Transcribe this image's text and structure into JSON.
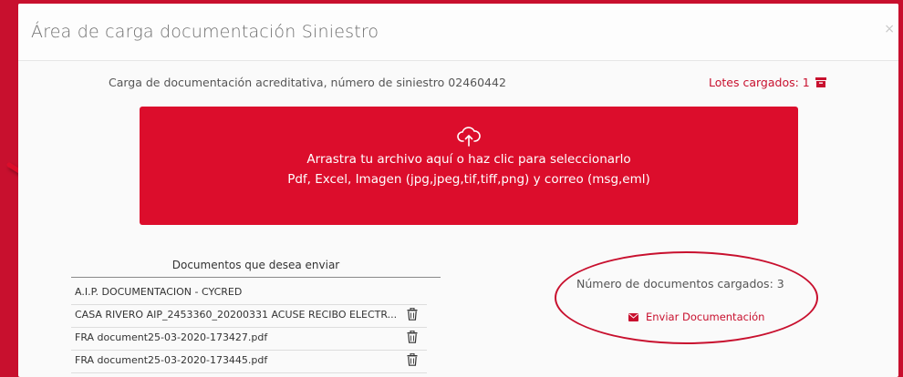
{
  "dialog": {
    "title": "Área de carga documentación Siniestro"
  },
  "upload": {
    "subtitle": "Carga de documentación acreditativa, número de siniestro 02460442",
    "lotes_label": "Lotes cargados: 1",
    "dropzone_line1": "Arrastra tu archivo aquí o haz clic para seleccionarlo",
    "dropzone_line2": "Pdf, Excel, Imagen (jpg,jpeg,tif,tiff,png) y correo (msg,eml)"
  },
  "documents": {
    "header": "Documentos que desea enviar",
    "items": [
      {
        "name": "A.I.P. DOCUMENTACION - CYCRED",
        "deletable": false
      },
      {
        "name": "CASA RIVERO AIP_2453360_20200331 ACUSE RECIBO ELECTR...",
        "deletable": true
      },
      {
        "name": "FRA document25-03-2020-173427.pdf",
        "deletable": true
      },
      {
        "name": "FRA document25-03-2020-173445.pdf",
        "deletable": true
      }
    ]
  },
  "summary": {
    "count_label": "Número de documentos cargados: 3",
    "send_label": "Enviar Documentación"
  },
  "icons": {
    "upload": "cloud-upload-icon",
    "lotes": "box-icon",
    "delete": "trash-icon",
    "send": "envelope-icon"
  },
  "colors": {
    "brand_red": "#c8102e",
    "dropzone_red": "#dc0d2c"
  }
}
